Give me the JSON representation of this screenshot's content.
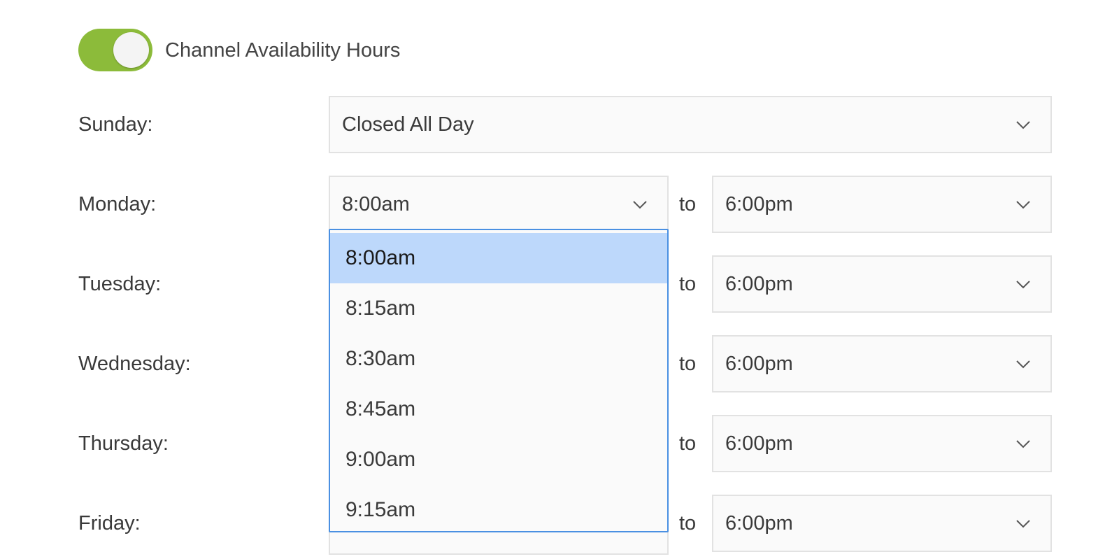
{
  "toggle": {
    "label": "Channel Availability Hours",
    "on": true,
    "accent_color": "#8cbb3a"
  },
  "days": [
    {
      "label": "Sunday:",
      "full_value": "Closed All Day"
    },
    {
      "label": "Monday:",
      "start": "8:00am",
      "to": "to",
      "end": "6:00pm"
    },
    {
      "label": "Tuesday:",
      "to": "to",
      "end": "6:00pm"
    },
    {
      "label": "Wednesday:",
      "to": "to",
      "end": "6:00pm"
    },
    {
      "label": "Thursday:",
      "to": "to",
      "end": "6:00pm"
    },
    {
      "label": "Friday:",
      "to": "to",
      "end": "6:00pm"
    }
  ],
  "dropdown": {
    "options": [
      "8:00am",
      "8:15am",
      "8:30am",
      "8:45am",
      "9:00am",
      "9:15am"
    ],
    "selected_index": 0,
    "highlight_color": "#bdd8fb",
    "border_color": "#4a90e2"
  },
  "icons": {
    "select_chevron": "chevron-down-icon"
  }
}
